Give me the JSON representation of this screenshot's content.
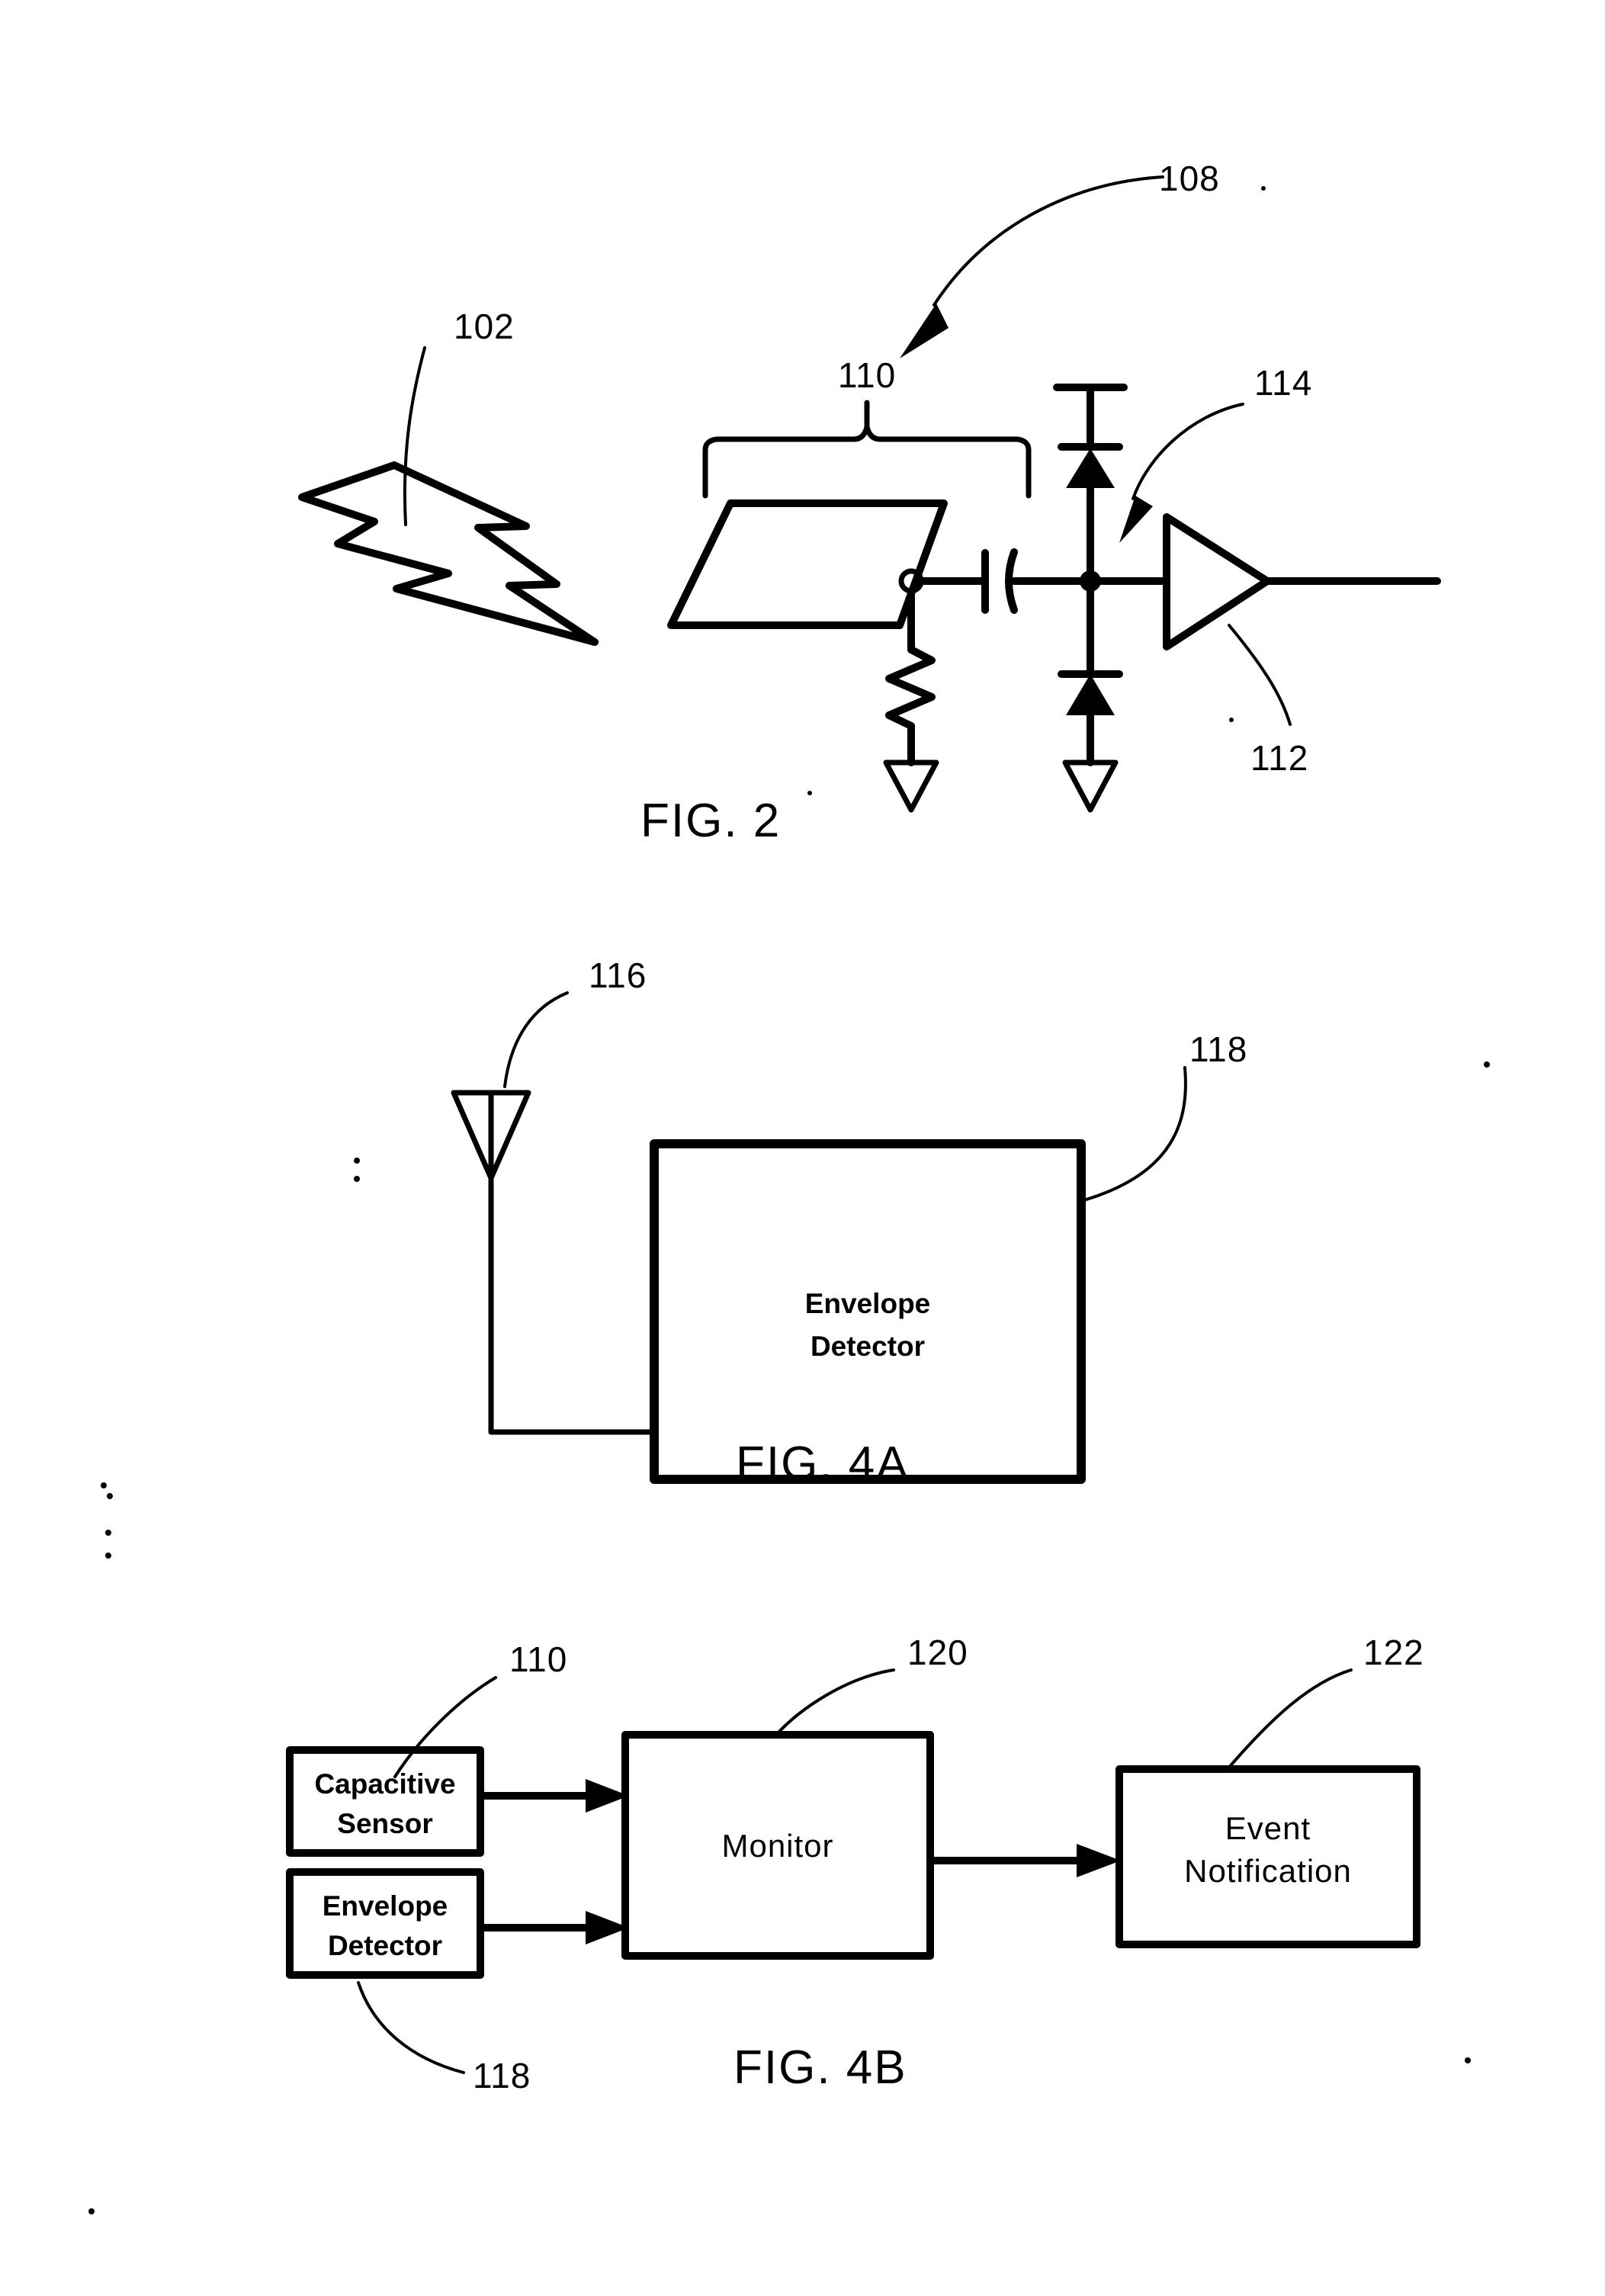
{
  "document": {
    "type": "patent-drawing-sheet",
    "background_color": "#ffffff",
    "ink_color": "#000000"
  },
  "figures": [
    {
      "id": "fig2",
      "caption": "FIG.  2",
      "reference_numerals": [
        "102",
        "108",
        "110",
        "112",
        "114"
      ],
      "elements": [
        {
          "name": "lightning-bolt",
          "label": "102",
          "description": "RF energy / electrostatic discharge event"
        },
        {
          "name": "capacitive-sensor-plate",
          "label": "110",
          "description": "parallelogram sensor plate with bracket"
        },
        {
          "name": "pull-down-resistor",
          "label": "",
          "description": "zigzag resistor to ground"
        },
        {
          "name": "ground-symbol-left",
          "label": "",
          "description": "triangle ground"
        },
        {
          "name": "coupling-capacitor",
          "label": "",
          "description": "series capacitor"
        },
        {
          "name": "clamp-diode-upper",
          "label": "114",
          "description": "upper clamp diode to supply rail"
        },
        {
          "name": "clamp-diode-lower",
          "label": "",
          "description": "lower clamp diode to ground"
        },
        {
          "name": "ground-symbol-right",
          "label": "",
          "description": "triangle ground"
        },
        {
          "name": "amplifier-triangle",
          "label": "112",
          "description": "buffer amplifier"
        },
        {
          "name": "overall-circuit-arrow",
          "label": "108",
          "description": "curved arrow to whole circuit"
        }
      ]
    },
    {
      "id": "fig4a",
      "caption": "FIG.  4A",
      "reference_numerals": [
        "116",
        "118"
      ],
      "elements": [
        {
          "name": "antenna",
          "label": "116",
          "description": "triangle antenna symbol"
        },
        {
          "name": "envelope-detector-block",
          "label": "118",
          "description": "rectangular block"
        }
      ],
      "blocks": [
        {
          "name": "envelope-detector",
          "ref": "118",
          "lines": [
            "Envelope",
            "Detector"
          ]
        }
      ]
    },
    {
      "id": "fig4b",
      "caption": "FIG.  4B",
      "reference_numerals": [
        "110",
        "118",
        "120",
        "122"
      ],
      "blocks": [
        {
          "name": "capacitive-sensor",
          "ref": "110",
          "lines": [
            "Capacitive",
            "Sensor"
          ]
        },
        {
          "name": "envelope-detector",
          "ref": "118",
          "lines": [
            "Envelope",
            "Detector"
          ]
        },
        {
          "name": "monitor",
          "ref": "120",
          "lines": [
            "Monitor"
          ]
        },
        {
          "name": "event-notification",
          "ref": "122",
          "lines": [
            "Event",
            "Notification"
          ]
        }
      ],
      "connections": [
        {
          "from": "capacitive-sensor",
          "to": "monitor",
          "style": "arrow"
        },
        {
          "from": "envelope-detector",
          "to": "monitor",
          "style": "arrow"
        },
        {
          "from": "monitor",
          "to": "event-notification",
          "style": "arrow"
        }
      ]
    }
  ],
  "labels": {
    "n102": "102",
    "n108": "108",
    "n110_fig2": "110",
    "n112": "112",
    "n114": "114",
    "n116": "116",
    "n118_fig4a": "118",
    "n110_fig4b": "110",
    "n120": "120",
    "n122": "122",
    "n118_fig4b": "118",
    "fig2_caption": "FIG.  2",
    "fig4a_caption": "FIG.  4A",
    "fig4b_caption": "FIG.  4B",
    "envelope_line1": "Envelope",
    "envelope_line2": "Detector",
    "capacitive_line1": "Capacitive",
    "capacitive_line2": "Sensor",
    "envelope4b_line1": "Envelope",
    "envelope4b_line2": "Detector",
    "monitor_label": "Monitor",
    "event_line1": "Event",
    "event_line2": "Notification"
  }
}
